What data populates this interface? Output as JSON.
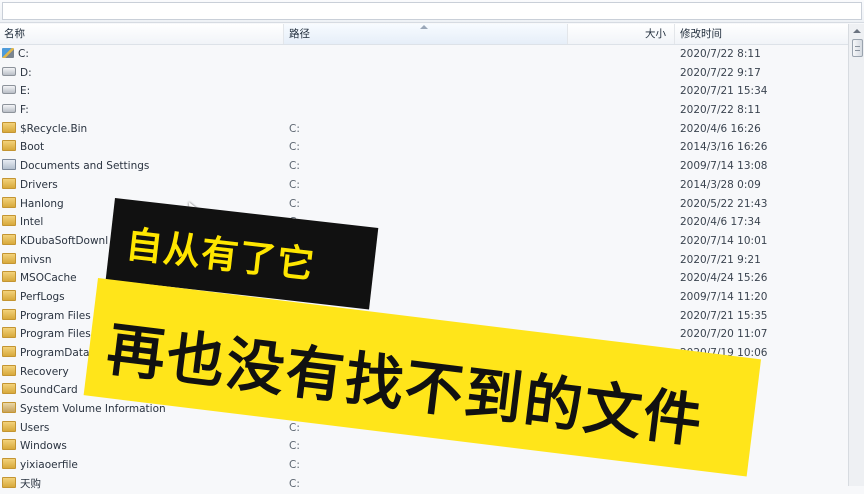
{
  "columns": {
    "name": "名称",
    "path": "路径",
    "size": "大小",
    "date": "修改时间"
  },
  "rows": [
    {
      "icon": "windows-drive-icon",
      "name": "C:",
      "path": "",
      "date": "2020/7/22 8:11"
    },
    {
      "icon": "drive-icon",
      "name": "D:",
      "path": "",
      "date": "2020/7/22 9:17"
    },
    {
      "icon": "drive-icon",
      "name": "E:",
      "path": "",
      "date": "2020/7/21 15:34"
    },
    {
      "icon": "drive-icon",
      "name": "F:",
      "path": "",
      "date": "2020/7/22 8:11"
    },
    {
      "icon": "folder-icon",
      "name": "$Recycle.Bin",
      "path": "C:",
      "date": "2020/4/6 16:26"
    },
    {
      "icon": "folder-icon",
      "name": "Boot",
      "path": "C:",
      "date": "2014/3/16 16:26"
    },
    {
      "icon": "shortcut-folder-icon",
      "name": "Documents and Settings",
      "path": "C:",
      "date": "2009/7/14 13:08"
    },
    {
      "icon": "folder-icon",
      "name": "Drivers",
      "path": "C:",
      "date": "2014/3/28 0:09"
    },
    {
      "icon": "folder-icon",
      "name": "Hanlong",
      "path": "C:",
      "date": "2020/5/22 21:43"
    },
    {
      "icon": "folder-icon",
      "name": "Intel",
      "path": "C:",
      "date": "2020/4/6 17:34"
    },
    {
      "icon": "folder-icon",
      "name": "KDubaSoftDownl",
      "path": "",
      "date": "2020/7/14 10:01"
    },
    {
      "icon": "folder-icon",
      "name": "mivsn",
      "path": "",
      "date": "2020/7/21 9:21"
    },
    {
      "icon": "folder-icon",
      "name": "MSOCache",
      "path": "",
      "date": "2020/4/24 15:26"
    },
    {
      "icon": "folder-icon",
      "name": "PerfLogs",
      "path": "",
      "date": "2009/7/14 11:20"
    },
    {
      "icon": "folder-icon",
      "name": "Program Files",
      "path": "",
      "date": "2020/7/21 15:35"
    },
    {
      "icon": "folder-icon",
      "name": "Program Files (x",
      "path": "",
      "date": "2020/7/20 11:07"
    },
    {
      "icon": "folder-icon",
      "name": "ProgramData",
      "path": "",
      "date": "2020/7/19 10:06"
    },
    {
      "icon": "folder-icon",
      "name": "Recovery",
      "path": "",
      "date": ""
    },
    {
      "icon": "folder-icon",
      "name": "SoundCard",
      "path": "",
      "date": ""
    },
    {
      "icon": "locked-folder-icon",
      "name": "System Volume Information",
      "path": "",
      "date": ""
    },
    {
      "icon": "folder-icon",
      "name": "Users",
      "path": "C:",
      "date": ""
    },
    {
      "icon": "folder-icon",
      "name": "Windows",
      "path": "C:",
      "date": ""
    },
    {
      "icon": "folder-icon",
      "name": "yixiaoerfile",
      "path": "C:",
      "date": ""
    },
    {
      "icon": "folder-icon",
      "name": "天购",
      "path": "C:",
      "date": ""
    }
  ],
  "overlay": {
    "line1": "自从有了它",
    "line2": "再也没有找不到的文件"
  }
}
